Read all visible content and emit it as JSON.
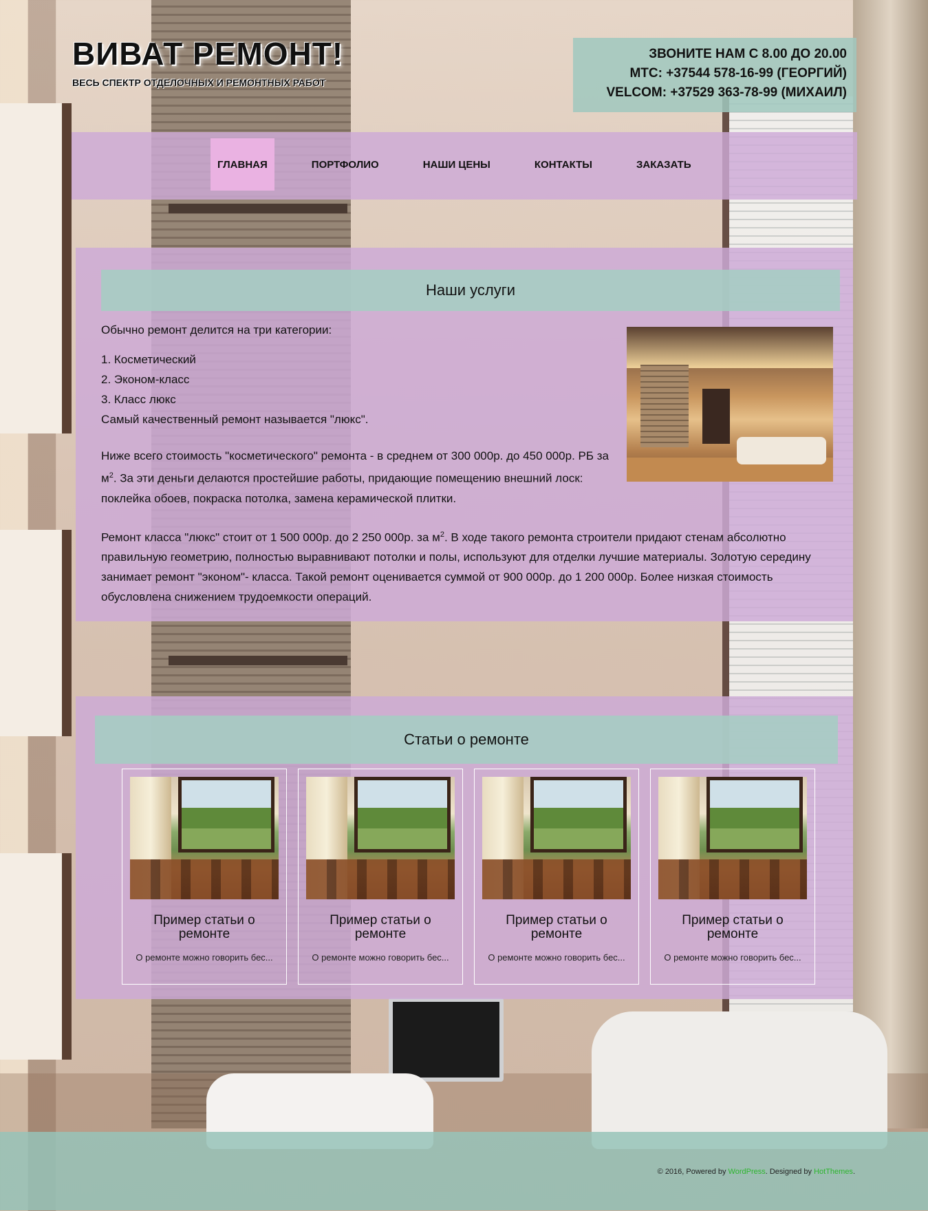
{
  "header": {
    "title": "ВИВАТ РЕМОНТ!",
    "subtitle": "ВЕСЬ СПЕКТР ОТДЕЛОЧНЫХ И РЕМОНТНЫХ РАБОТ"
  },
  "contacts": {
    "hours": "ЗВОНИТЕ НАМ С 8.00 ДО 20.00",
    "mts": "МТС: +37544 578-16-99 (ГЕОРГИЙ)",
    "velcom": "VELCOM: +37529 363-78-99 (МИХАИЛ)"
  },
  "nav": {
    "items": [
      {
        "label": "ГЛАВНАЯ",
        "active": true
      },
      {
        "label": "ПОРТФОЛИО"
      },
      {
        "label": "НАШИ ЦЕНЫ"
      },
      {
        "label": "КОНТАКТЫ"
      },
      {
        "label": "ЗАКАЗАТЬ"
      }
    ]
  },
  "services": {
    "heading": "Наши услуги",
    "intro": "Обычно ремонт делится на три категории:",
    "categories": [
      "Косметический",
      "Эконом-класс",
      "Класс люкс"
    ],
    "best": "Самый качественный ремонт называется \"люкс\".",
    "para2_a": "Ниже всего стоимость \"косметического\" ремонта - в среднем от 300 000р. до 450 000р. РБ за м",
    "para2_sup": "2",
    "para2_b": ". За эти деньги делаются простейшие работы, придающие помещению внешний лоск: поклейка обоев, покраска потолка, замена керамической плитки.",
    "para3_a": "Ремонт класса \"люкс\" стоит от 1 500 000р. до 2 250 000р. за м",
    "para3_sup": "2",
    "para3_b": ". В ходе такого ремонта строители придают стенам абсолютно правильную геометрию, полностью выравнивают потолки и полы, используют для отделки лучшие материалы. Золотую середину занимает ремонт \"эконом\"- класса. Такой ремонт оценивается суммой от 900 000р. до 1 200 000р. Более низкая стоимость обусловлена снижением трудоемкости операций."
  },
  "articles": {
    "heading": "Статьи о ремонте",
    "items": [
      {
        "title": "Пример статьи о ремонте",
        "excerpt": "О ремонте можно говорить бес..."
      },
      {
        "title": "Пример статьи о ремонте",
        "excerpt": "О ремонте можно говорить бес..."
      },
      {
        "title": "Пример статьи о ремонте",
        "excerpt": "О ремонте можно говорить бес..."
      },
      {
        "title": "Пример статьи о ремонте",
        "excerpt": "О ремонте можно говорить бес..."
      }
    ]
  },
  "footer": {
    "prefix": "© 2016, Powered by ",
    "wordpress": "WordPress",
    "designed": ". Designed by ",
    "designer": "HotThemes",
    "suffix": "."
  },
  "colors": {
    "panel": "#cdaad7",
    "band": "#a5cdc3",
    "nav_active": "#eab2e2",
    "footer_link": "#2db52d"
  }
}
